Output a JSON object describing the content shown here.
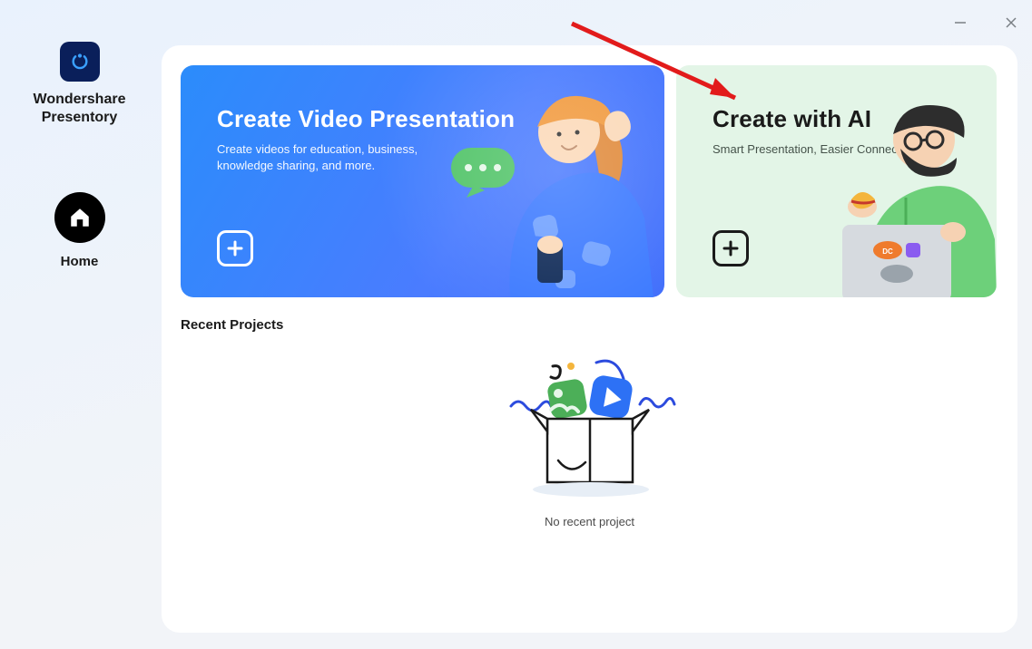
{
  "app": {
    "name_line1": "Wondershare",
    "name_line2": "Presentory"
  },
  "nav": {
    "home_label": "Home"
  },
  "cards": {
    "video": {
      "title": "Create Video Presentation",
      "subtitle": "Create videos for education, business, knowledge sharing, and more."
    },
    "ai": {
      "title": "Create with AI",
      "subtitle": "Smart Presentation, Easier Connection."
    }
  },
  "recent": {
    "section_title": "Recent Projects",
    "empty_text": "No recent project"
  }
}
